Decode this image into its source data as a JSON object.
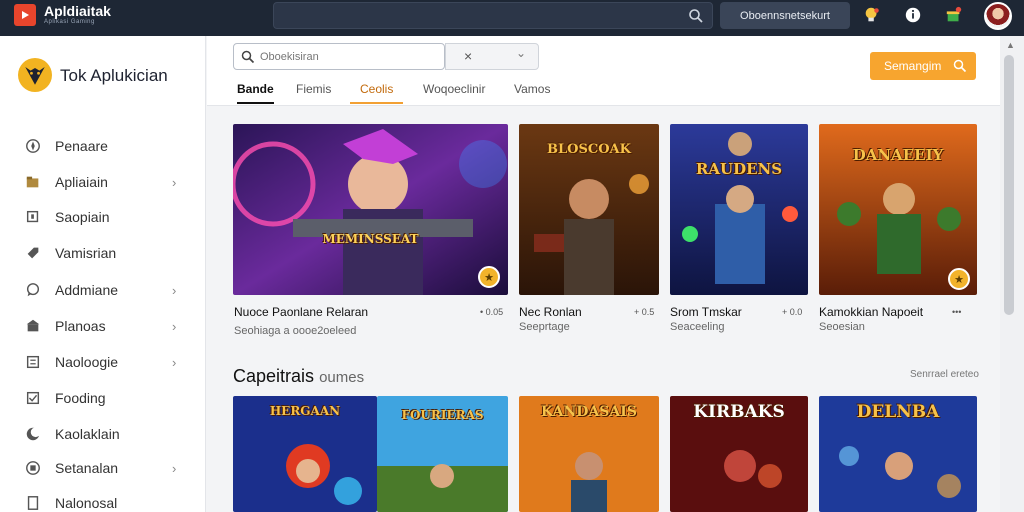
{
  "topbar": {
    "title": "Apldiaitak",
    "subtitle": "Aplikasi Gaming",
    "button_label": "Oboennsnetsekurt"
  },
  "sidebar": {
    "brand": "Tok Aplukician",
    "items": [
      {
        "label": "Penaare",
        "icon": "compass-icon",
        "chevron": false
      },
      {
        "label": "Apliaiain",
        "icon": "folder-icon",
        "chevron": true
      },
      {
        "label": "Saopiain",
        "icon": "square-icon",
        "chevron": false
      },
      {
        "label": "Vamisrian",
        "icon": "tag-icon",
        "chevron": false
      },
      {
        "label": "Addmiane",
        "icon": "chat-icon",
        "chevron": true
      },
      {
        "label": "Planoas",
        "icon": "shop-icon",
        "chevron": true
      },
      {
        "label": "Naoloogie",
        "icon": "book-icon",
        "chevron": true
      },
      {
        "label": "Fooding",
        "icon": "check-icon",
        "chevron": false
      },
      {
        "label": "Kaolaklain",
        "icon": "moon-icon",
        "chevron": false
      },
      {
        "label": "Setanalan",
        "icon": "grid-icon",
        "chevron": true
      },
      {
        "label": "Nalonosal",
        "icon": "doc-icon",
        "chevron": false
      }
    ]
  },
  "toolbar": {
    "search_placeholder": "Oboekisiran",
    "filter_label": "×",
    "filter_arrow": "⌄",
    "orange_button": "Semangim",
    "tabs": [
      "Bande",
      "Fiemis",
      "Ceolis",
      "Woqoeclinir",
      "Vamos"
    ]
  },
  "cards_top": [
    {
      "title": "Nuoce Paonlane Relaran",
      "sub": "Seohiaga a oooe2oeleed",
      "meta": "• 0.05",
      "art": "MEMINSSEAT"
    },
    {
      "title": "Nec Ronlan",
      "sub": "Seeprtage",
      "meta": "+ 0.5",
      "art": "BLOSCOAK"
    },
    {
      "title": "Srom Tmskar",
      "sub": "Seaceeling",
      "meta": "+ 0.0",
      "art": "RAUDENS"
    },
    {
      "title": "Kamokkian Napoeit",
      "sub": "Seoesian",
      "meta": "•••",
      "art": "DANAEEIY"
    }
  ],
  "section": {
    "title": "Capeitrais",
    "title_suffix": "oumes",
    "link": "Senrrael ereteo"
  },
  "cards_bottom": [
    {
      "art": "HERGAAN"
    },
    {
      "art": "FOURIERAS"
    },
    {
      "art": "KANDASAIS"
    },
    {
      "art": "KIRBAKS"
    },
    {
      "art": "DELNBA"
    }
  ],
  "colors": {
    "topbar": "#1e2735",
    "accent_orange": "#f7a52f",
    "logo_red": "#e8452c"
  }
}
